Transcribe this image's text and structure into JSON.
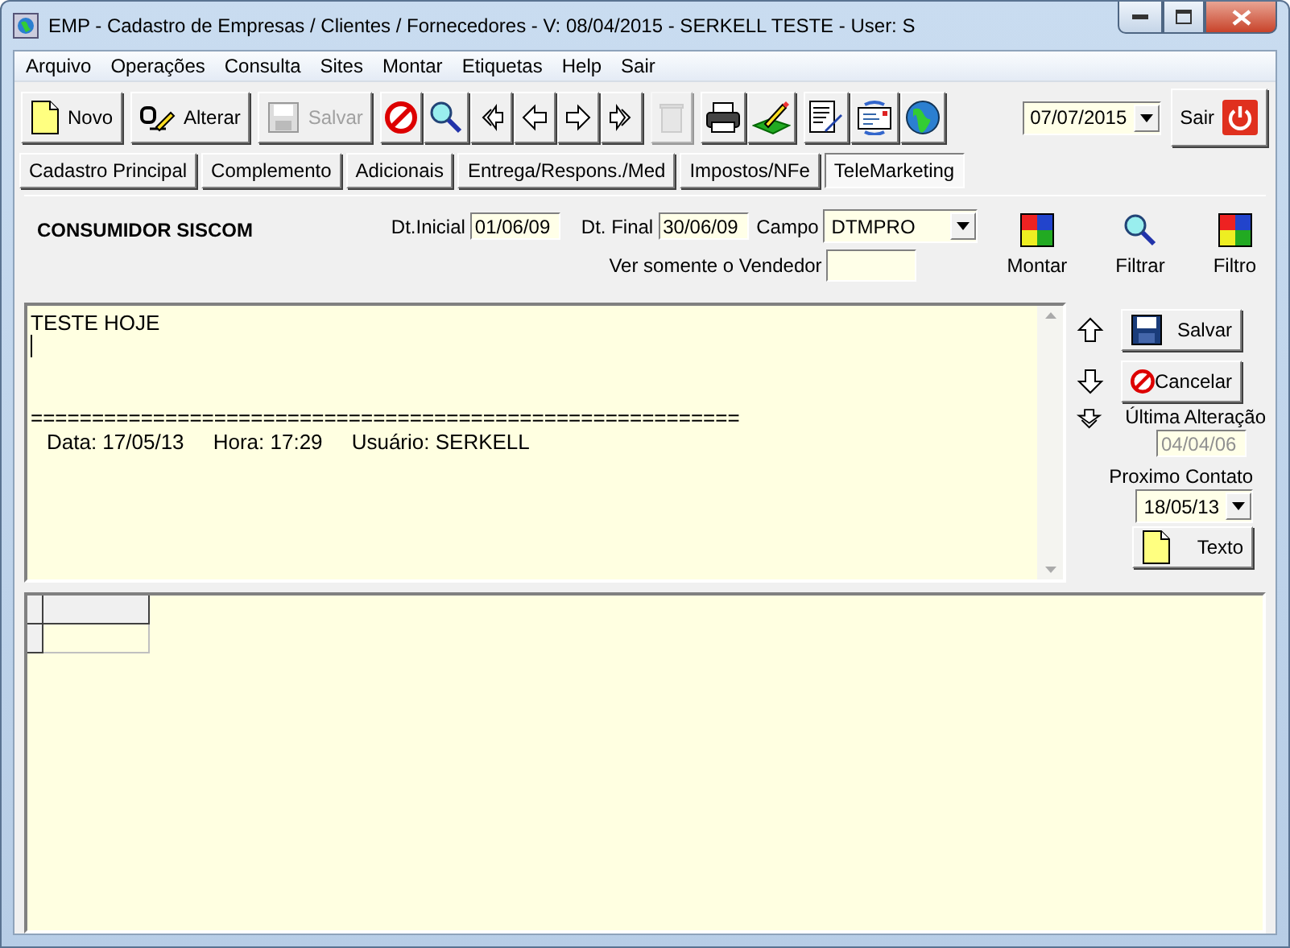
{
  "window": {
    "title": "EMP - Cadastro de Empresas / Clientes / Fornecedores - V: 08/04/2015 - SERKELL TESTE - User: S"
  },
  "menu": [
    "Arquivo",
    "Operações",
    "Consulta",
    "Sites",
    "Montar",
    "Etiquetas",
    "Help",
    "Sair"
  ],
  "toolbar": {
    "buttons": [
      {
        "label": "Novo",
        "disabled": false
      },
      {
        "label": "Alterar",
        "disabled": false
      },
      {
        "label": "Salvar",
        "disabled": true
      },
      {
        "disabled": false
      },
      {
        "disabled": false
      },
      {
        "disabled": false
      },
      {
        "disabled": false
      },
      {
        "disabled": false
      },
      {
        "disabled": false
      },
      {
        "disabled": true
      },
      {
        "disabled": false
      },
      {
        "disabled": false
      },
      {
        "disabled": false
      },
      {
        "disabled": false
      },
      {
        "disabled": false
      }
    ],
    "date": "07/07/2015",
    "exit_label": "Sair"
  },
  "tabs": [
    {
      "label": "Cadastro Principal",
      "selected": false
    },
    {
      "label": "Complemento",
      "selected": false
    },
    {
      "label": "Adicionais",
      "selected": false
    },
    {
      "label": "Entrega/Respons./Med",
      "selected": false
    },
    {
      "label": "Impostos/NFe",
      "selected": false
    },
    {
      "label": "TeleMarketing",
      "selected": true
    }
  ],
  "filter": {
    "customer": "CONSUMIDOR SISCOM",
    "start_label": "Dt.Inicial",
    "start": "01/06/09",
    "end_label": "Dt. Final",
    "end": "30/06/09",
    "field_label": "Campo",
    "field": "DTMPRO",
    "seller_label": "Ver somente o Vendedor",
    "actions": [
      "Montar",
      "Filtrar",
      "Filtro"
    ]
  },
  "memo": {
    "lines": [
      "TESTE HOJE",
      "==========================================================",
      "Data: 17/05/13     Hora: 17:29     Usuário: SERKELL"
    ]
  },
  "side": {
    "save": "Salvar",
    "cancel": "Cancelar",
    "last_change_label": "Última Alteração",
    "last_change": "04/04/06",
    "next_contact_label": "Proximo Contato",
    "next_contact": "18/05/13",
    "text_button": "Texto"
  }
}
